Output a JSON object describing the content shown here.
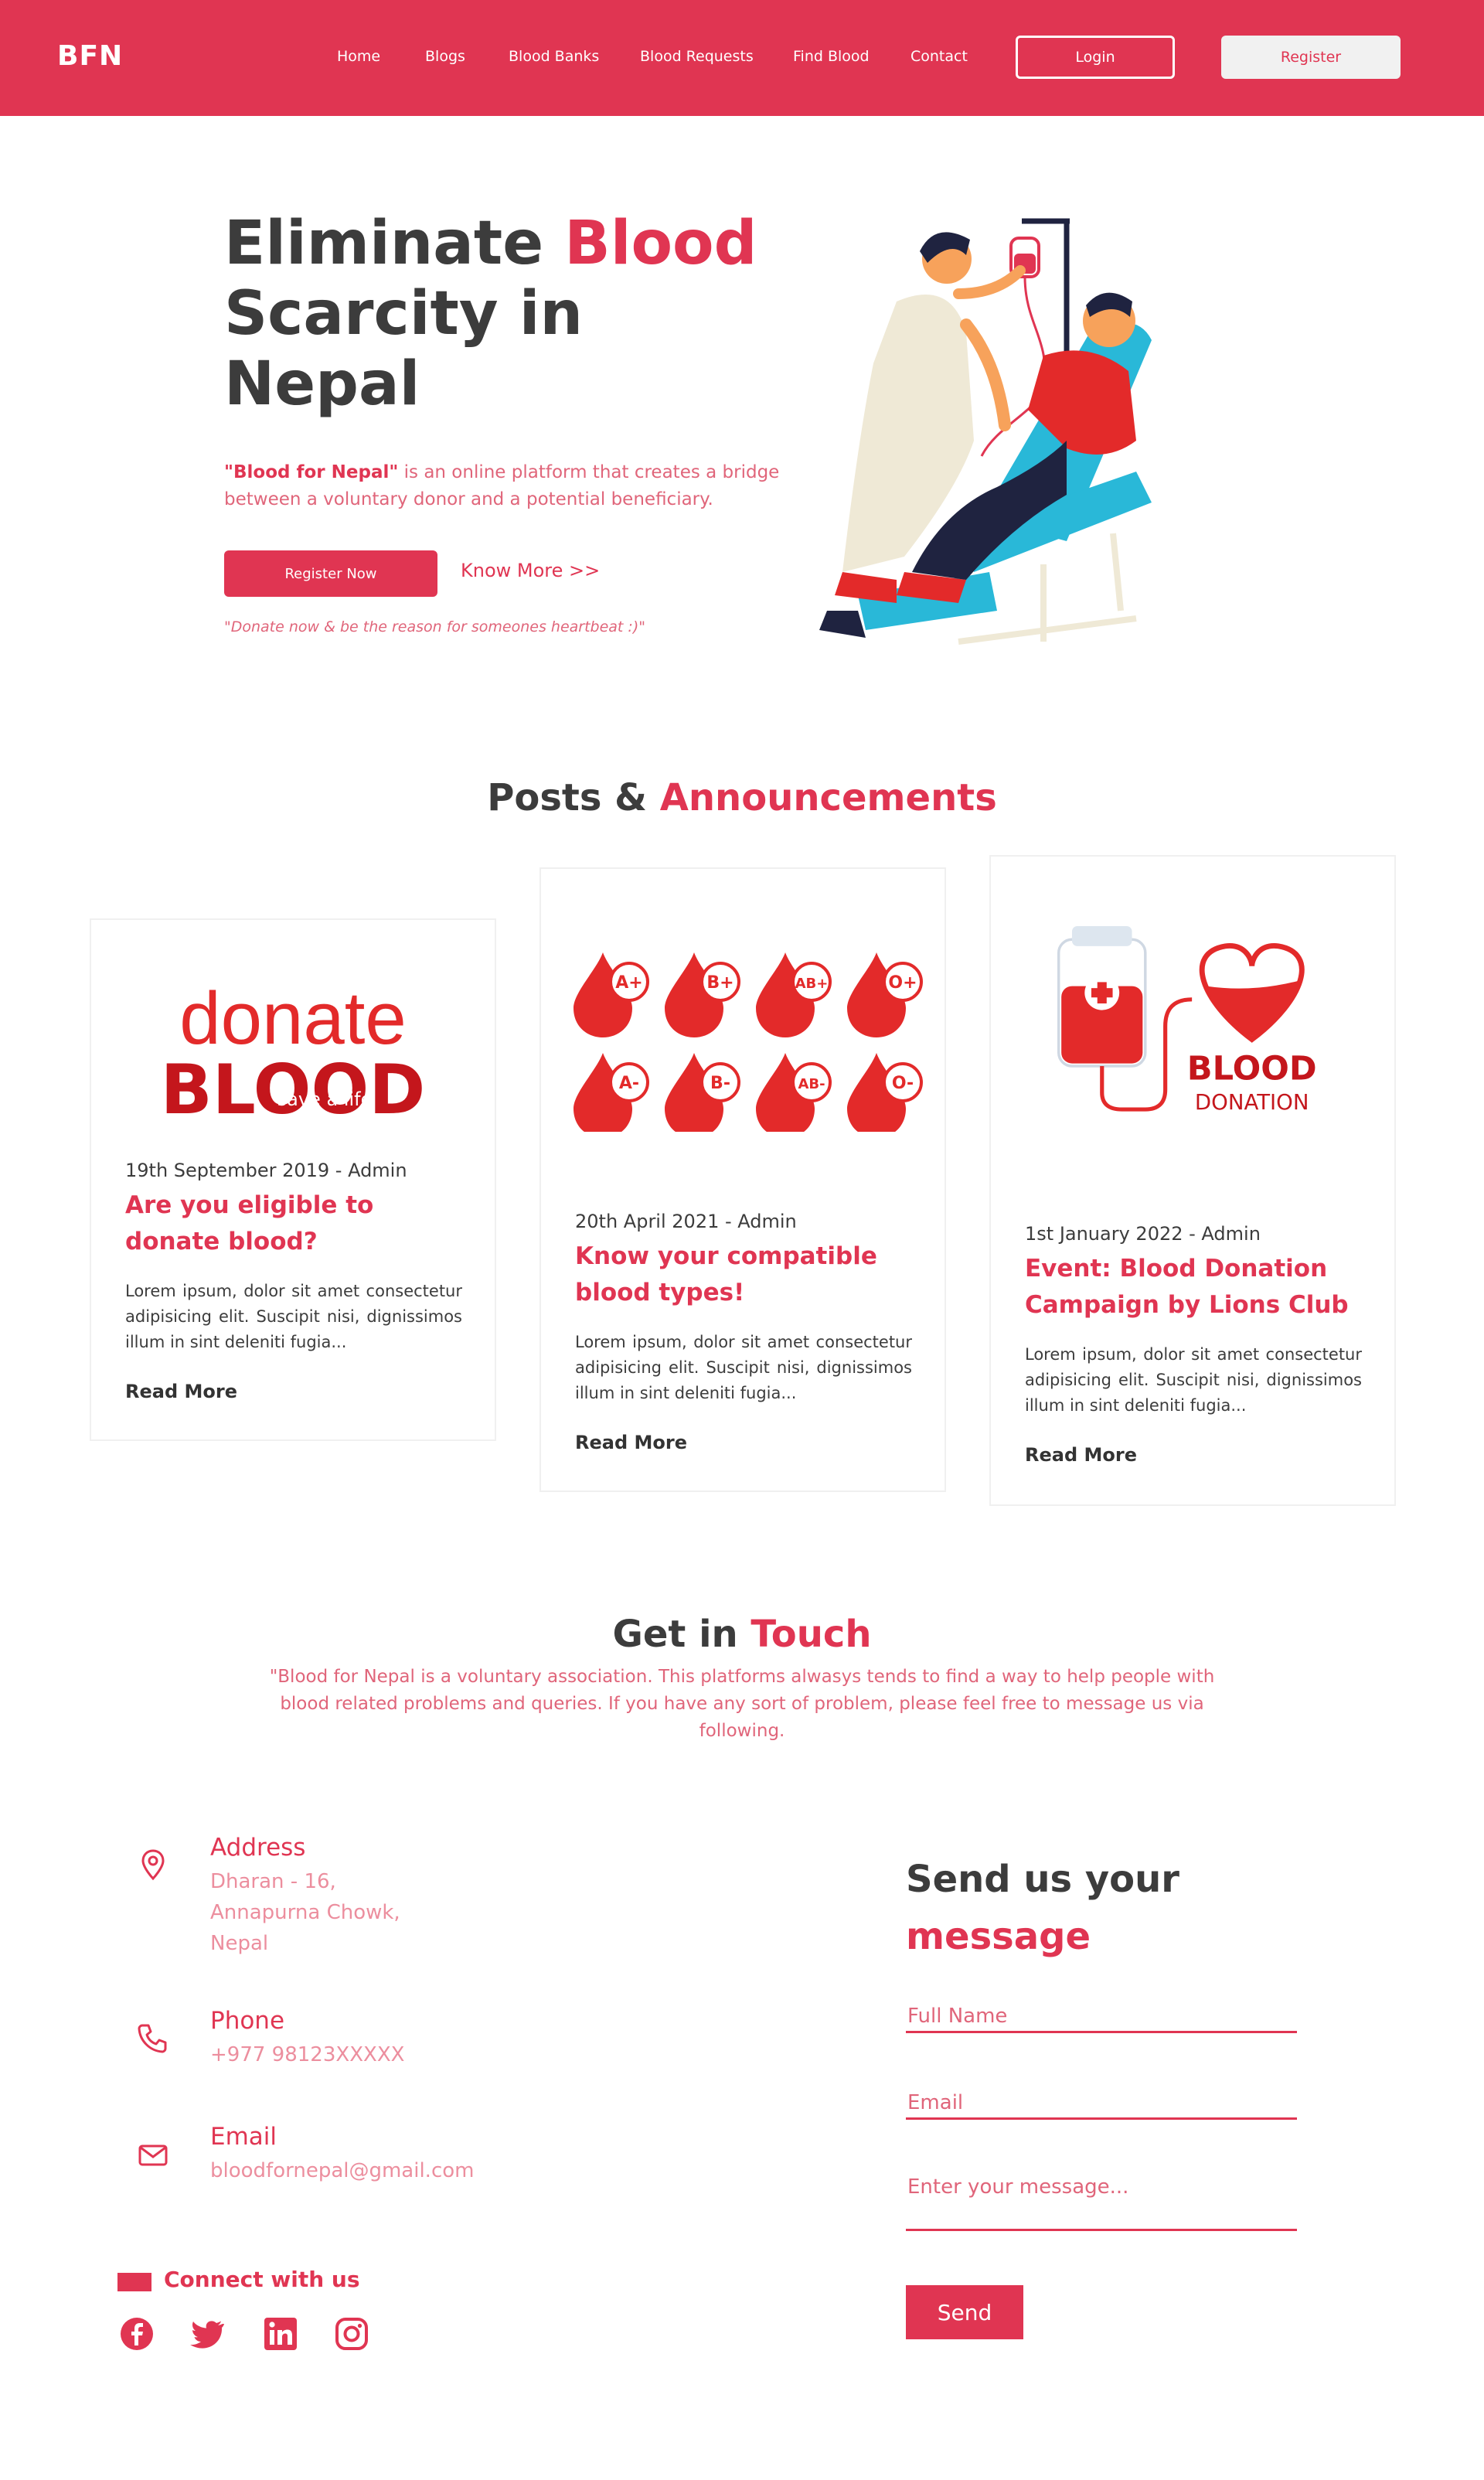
{
  "nav": {
    "logo": "BFN",
    "links": [
      "Home",
      "Blogs",
      "Blood Banks",
      "Blood Requests",
      "Find Blood",
      "Contact"
    ],
    "login": "Login",
    "register": "Register"
  },
  "hero": {
    "title_part1": "Eliminate ",
    "title_accent": "Blood",
    "title_part2": "Scarcity in Nepal",
    "desc_bold": "\"Blood for Nepal\"",
    "desc_rest": " is an online platform that creates a bridge between a voluntary donor and a potential beneficiary.",
    "register_now": "Register Now",
    "know_more": "Know More >>",
    "tagline": "\"Donate now & be the reason for someones heartbeat :)\""
  },
  "posts": {
    "title_part1": "Posts & ",
    "title_accent": "Announcements",
    "cards": [
      {
        "image_text_1": "donate",
        "image_text_2": "BLOOD",
        "image_text_3": "save a life",
        "meta": "19th September 2019 - Admin",
        "title": "Are you eligible to donate blood?",
        "body": "Lorem ipsum, dolor sit amet consectetur adipisicing elit. Suscipit nisi, dignissimos illum in sint deleniti fugia...",
        "read_more": "Read More"
      },
      {
        "image_groups": [
          "A+",
          "B+",
          "AB+",
          "O+",
          "A-",
          "B-",
          "AB-",
          "O-"
        ],
        "meta": "20th April 2021 - Admin",
        "title": "Know your compatible blood types!",
        "body": "Lorem ipsum, dolor sit amet consectetur adipisicing elit. Suscipit nisi, dignissimos illum in sint deleniti fugia...",
        "read_more": "Read More"
      },
      {
        "image_text_1": "BLOOD",
        "image_text_2": "DONATION",
        "meta": "1st January 2022 - Admin",
        "title": "Event: Blood Donation Campaign by Lions Club",
        "body": "Lorem ipsum, dolor sit amet consectetur adipisicing elit. Suscipit nisi, dignissimos illum in sint deleniti fugia...",
        "read_more": "Read More"
      }
    ]
  },
  "contact": {
    "title_part1": "Get in ",
    "title_accent": "Touch",
    "desc": "\"Blood for Nepal is a voluntary association. This platforms alwasys tends to find a way to help people with blood related problems and queries. If you have any sort of problem, please feel free to message us via following.",
    "address_label": "Address",
    "address_lines": [
      "Dharan - 16,",
      "Annapurna Chowk,",
      "Nepal"
    ],
    "phone_label": "Phone",
    "phone_value": "+977 98123XXXXX",
    "email_label": "Email",
    "email_value": "bloodfornepal@gmail.com",
    "connect_label": "Connect with us",
    "socials": [
      "facebook-icon",
      "twitter-icon",
      "linkedin-icon",
      "instagram-icon"
    ]
  },
  "form": {
    "title_part1": "Send us your",
    "title_accent": "message",
    "name_placeholder": "Full Name",
    "email_placeholder": "Email",
    "message_placeholder": "Enter your message...",
    "send": "Send"
  },
  "colors": {
    "primary": "#e03552",
    "text_dark": "#3c3c3c",
    "muted_pink": "#e0657a",
    "light_pink": "#ec8e9e",
    "chair_blue": "#29b8d8"
  }
}
